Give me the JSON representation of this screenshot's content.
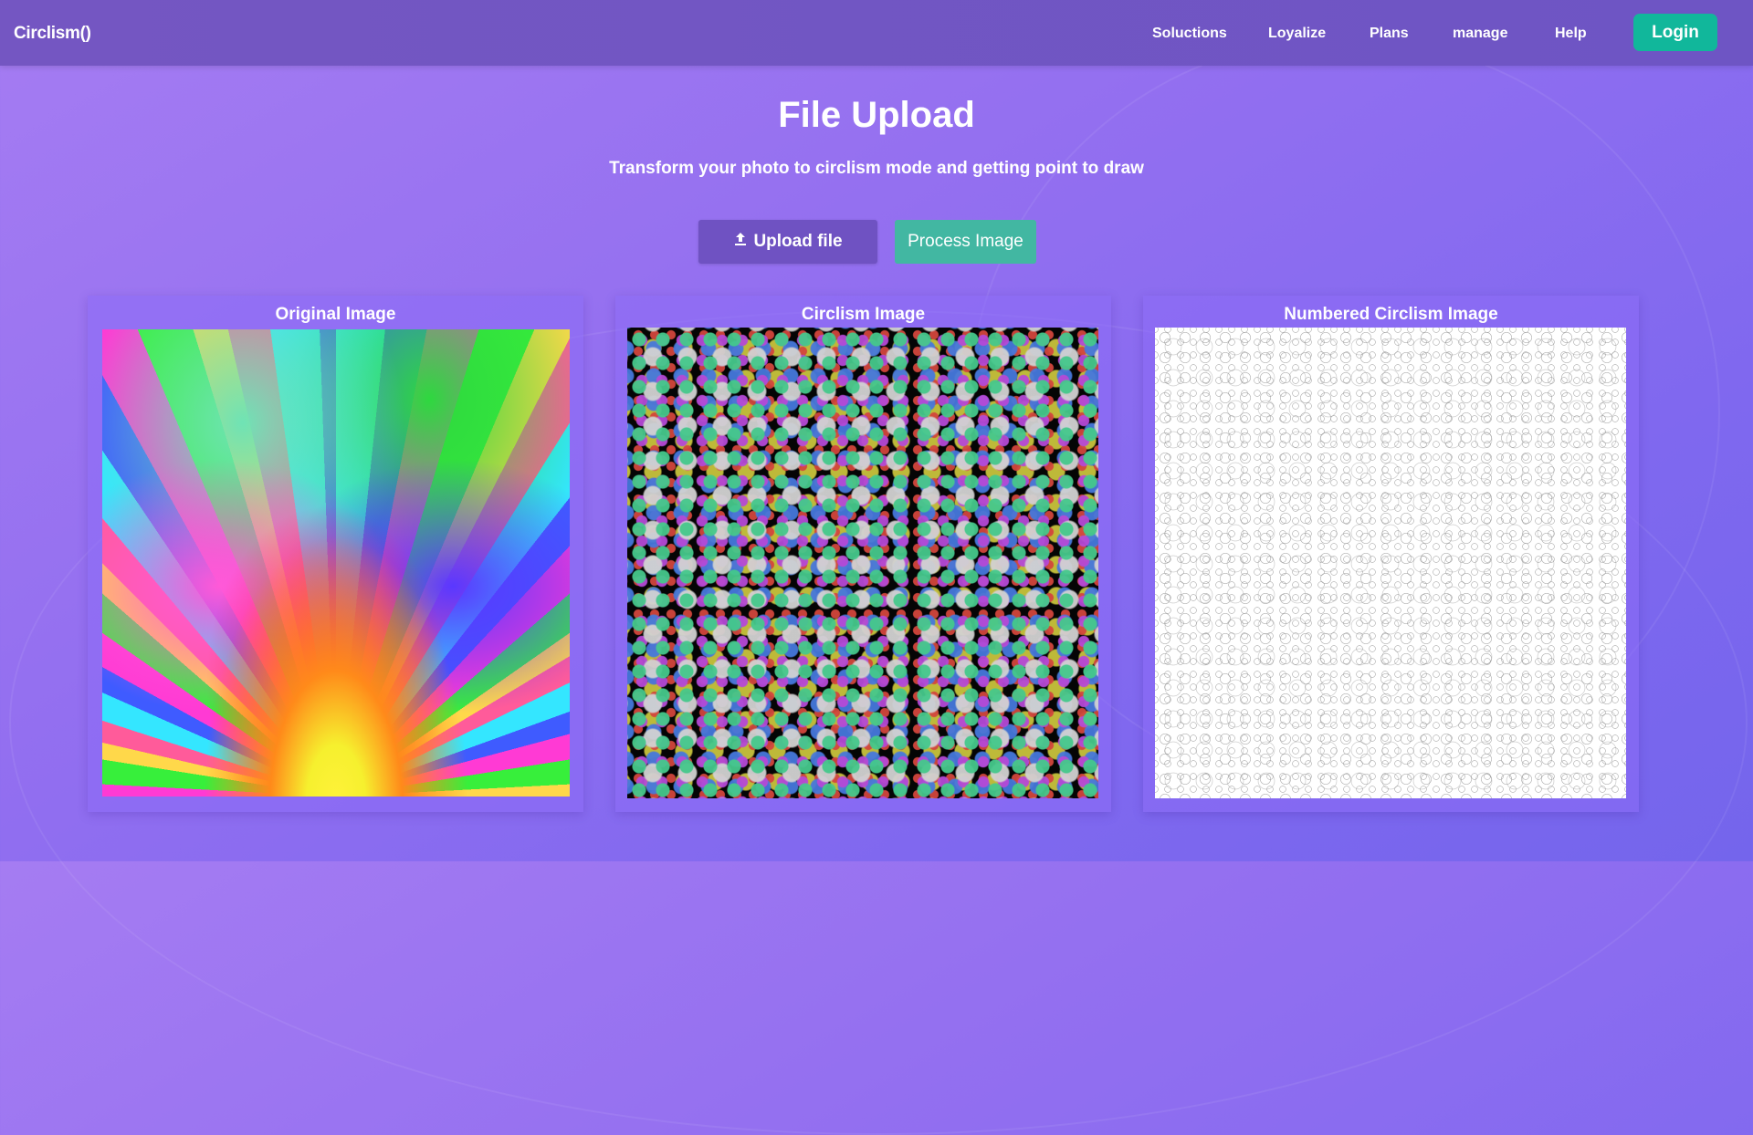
{
  "brand": "Circlism()",
  "nav": {
    "links": [
      "Soluctions",
      "Loyalize",
      "Plans",
      "manage",
      "Help"
    ],
    "login_label": "Login"
  },
  "hero": {
    "title": "File Upload",
    "subtitle": "Transform your photo to circlism mode and getting point to draw"
  },
  "actions": {
    "upload_label": "Upload file",
    "upload_icon": "upload-icon",
    "process_label": "Process Image"
  },
  "cards": [
    {
      "title": "Original Image"
    },
    {
      "title": "Circlism Image"
    },
    {
      "title": "Numbered Circlism Image"
    }
  ],
  "colors": {
    "navbar": "#7456c2",
    "login": "#11b79b",
    "upload": "#6f52c2",
    "process": "#42b7a2"
  }
}
